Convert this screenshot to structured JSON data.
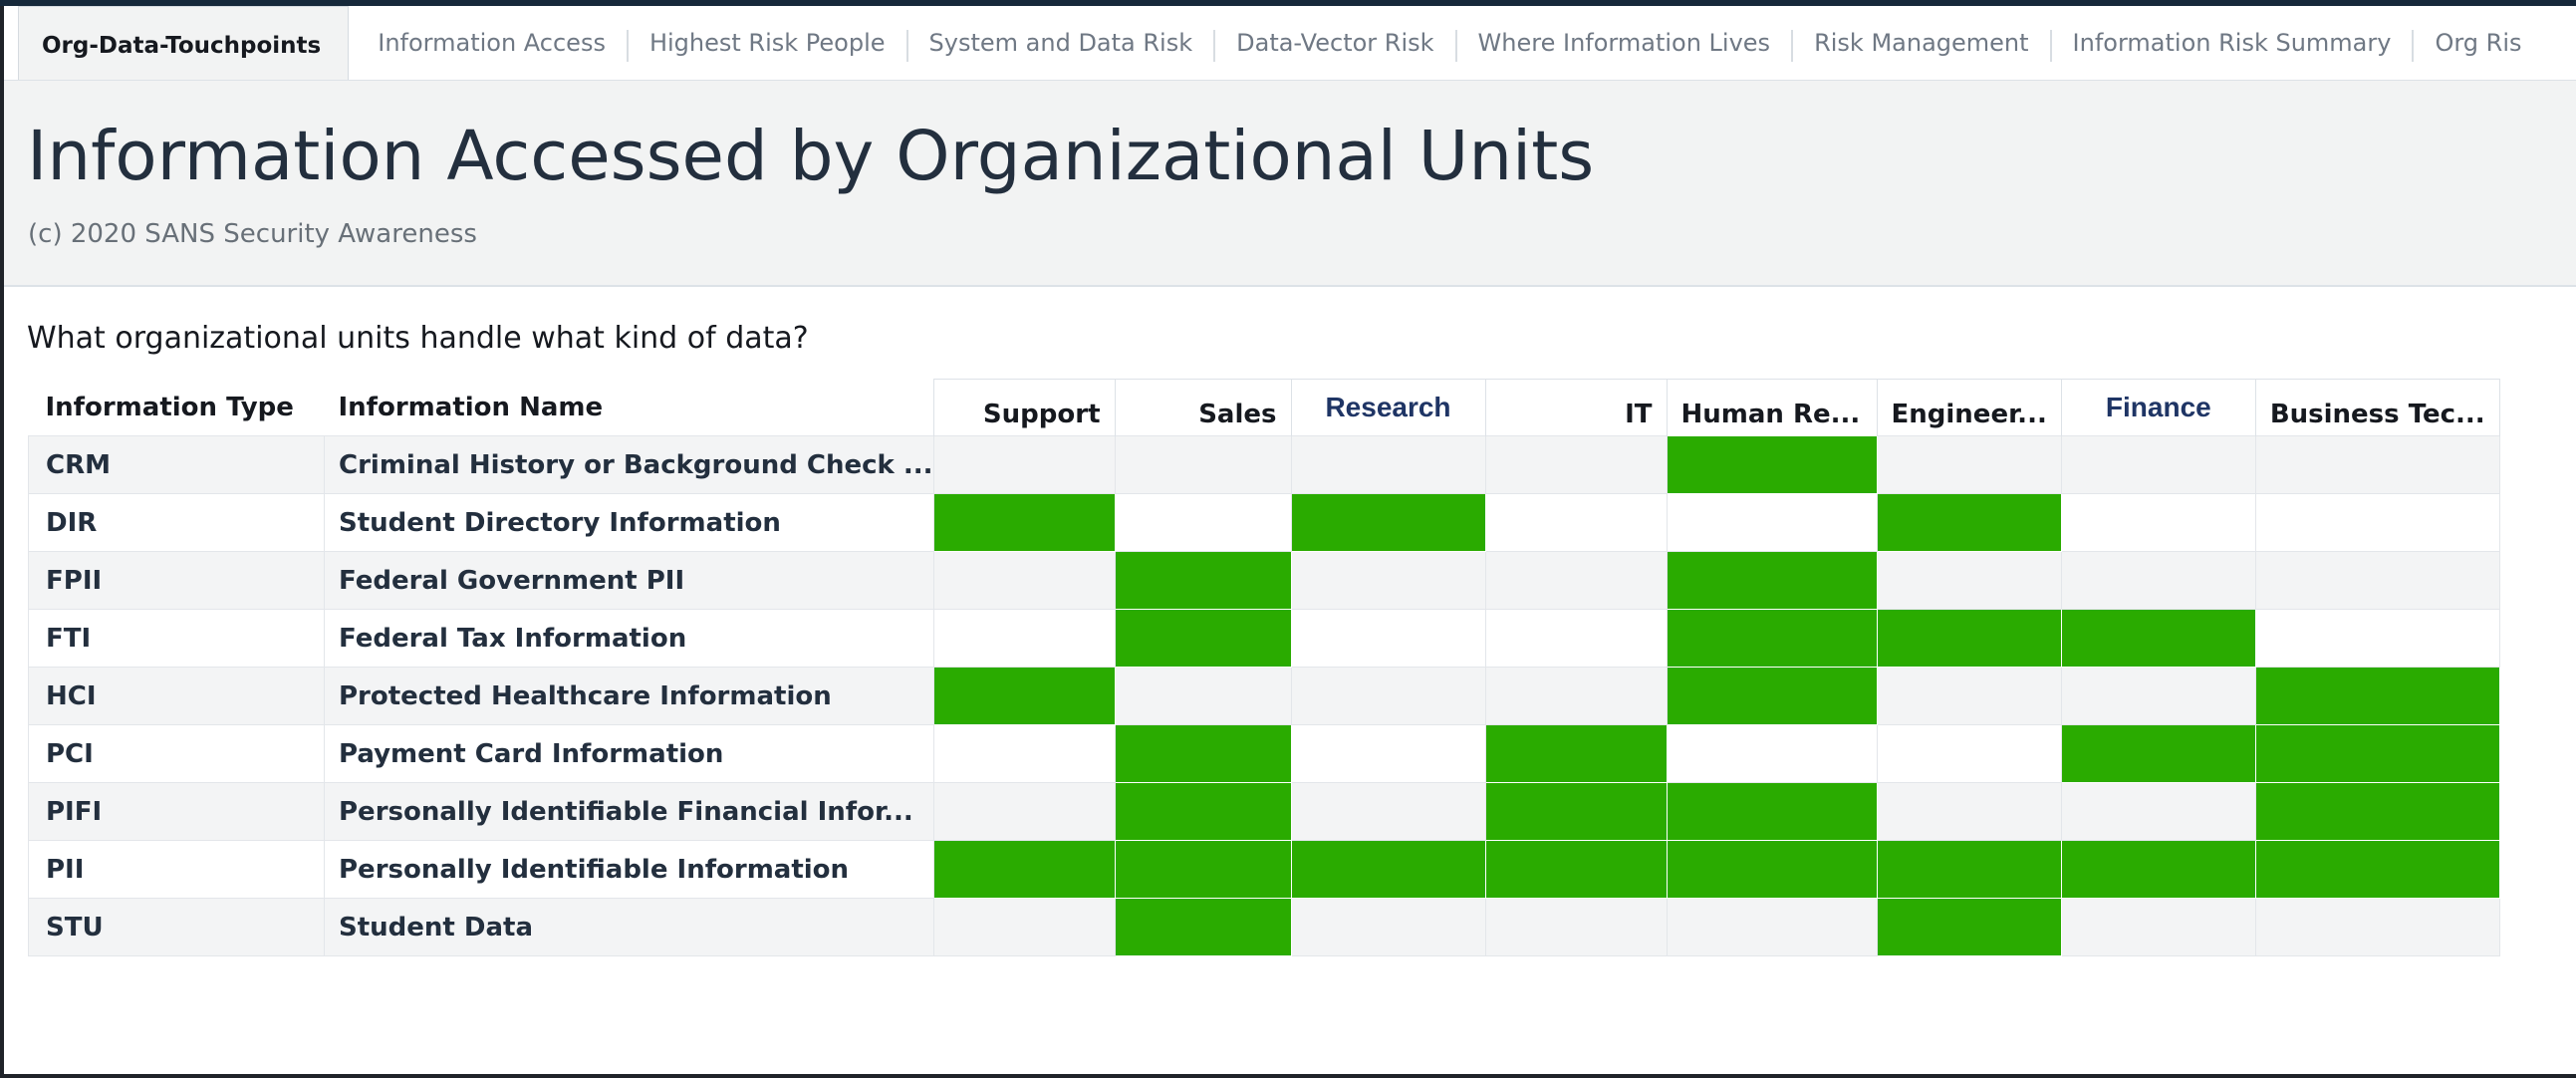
{
  "tabs": [
    {
      "label": "Org-Data-Touchpoints",
      "active": true
    },
    {
      "label": "Information Access",
      "active": false
    },
    {
      "label": "Highest Risk People",
      "active": false
    },
    {
      "label": "System and Data Risk",
      "active": false
    },
    {
      "label": "Data-Vector Risk",
      "active": false
    },
    {
      "label": "Where Information Lives",
      "active": false
    },
    {
      "label": "Risk Management",
      "active": false
    },
    {
      "label": "Information Risk Summary",
      "active": false
    },
    {
      "label": "Org Ris",
      "active": false
    }
  ],
  "header": {
    "title": "Information Accessed by Organizational Units",
    "subtitle": "(c) 2020 SANS Security Awareness"
  },
  "question": "What organizational units handle what kind of data?",
  "colors": {
    "on": "#2aab00",
    "header_bg": "#f2f3f3",
    "title": "#232f3e"
  },
  "table": {
    "row_headers": [
      "Information Type",
      "Information Name"
    ],
    "columns": [
      "Support",
      "Sales",
      "Research",
      "IT",
      "Human Re...",
      "Engineer...",
      "Finance",
      "Business Tec..."
    ],
    "rows": [
      {
        "type": "CRM",
        "name": "Criminal History or Background Check ...",
        "cells": [
          0,
          0,
          0,
          0,
          1,
          0,
          0,
          0
        ]
      },
      {
        "type": "DIR",
        "name": "Student Directory Information",
        "cells": [
          1,
          0,
          1,
          0,
          0,
          1,
          0,
          0
        ]
      },
      {
        "type": "FPII",
        "name": "Federal Government PII",
        "cells": [
          0,
          1,
          0,
          0,
          1,
          0,
          0,
          0
        ]
      },
      {
        "type": "FTI",
        "name": "Federal Tax Information",
        "cells": [
          0,
          1,
          0,
          0,
          1,
          1,
          1,
          0
        ]
      },
      {
        "type": "HCI",
        "name": "Protected Healthcare Information",
        "cells": [
          1,
          0,
          0,
          0,
          1,
          0,
          0,
          1
        ]
      },
      {
        "type": "PCI",
        "name": "Payment Card Information",
        "cells": [
          0,
          1,
          0,
          1,
          0,
          0,
          1,
          1
        ]
      },
      {
        "type": "PIFI",
        "name": "Personally Identifiable Financial Infor...",
        "cells": [
          0,
          1,
          0,
          1,
          1,
          0,
          0,
          1
        ]
      },
      {
        "type": "PII",
        "name": "Personally Identifiable Information",
        "cells": [
          1,
          1,
          1,
          1,
          1,
          1,
          1,
          1
        ]
      },
      {
        "type": "STU",
        "name": "Student Data",
        "cells": [
          0,
          1,
          0,
          0,
          0,
          1,
          0,
          0
        ]
      }
    ]
  }
}
